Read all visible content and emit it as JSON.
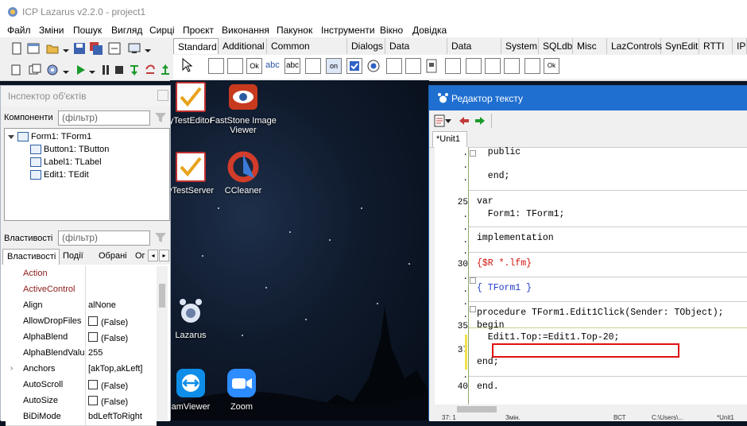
{
  "window": {
    "title": "ICP Lazarus v2.2.0 - project1"
  },
  "menu": [
    "Файл",
    "Зміни",
    "Пошук",
    "Вигляд",
    "Сирці",
    "Проєкт",
    "Виконання",
    "Пакунок",
    "Інструменти",
    "Вікно",
    "Довідка"
  ],
  "palette": {
    "tabs": [
      "Standard",
      "Additional",
      "Common Controls",
      "Dialogs",
      "Data Controls",
      "Data Access",
      "System",
      "SQLdb",
      "Misc",
      "LazControls",
      "SynEdit",
      "RTTI",
      "IPro"
    ],
    "active_tab": "Standard",
    "icon_labels": {
      "ok": "Ok",
      "abc": "abc",
      "on": "on"
    }
  },
  "desktop": {
    "icons": [
      {
        "label": "yTestEditor"
      },
      {
        "label": "FastStone Image Viewer"
      },
      {
        "label": "yTestServer"
      },
      {
        "label": "CCleaner"
      },
      {
        "label": "Lazarus"
      },
      {
        "label": "amViewer"
      },
      {
        "label": "Zoom"
      }
    ]
  },
  "inspector": {
    "title": "Інспектор об'єктів",
    "components_label": "Компоненти",
    "filter_placeholder": "(фільтр)",
    "tree": [
      "Form1: TForm1",
      "Button1: TButton",
      "Label1: TLabel",
      "Edit1: TEdit"
    ],
    "properties_label": "Властивості",
    "tabs": [
      "Властивості",
      "Події",
      "Обрані",
      "Ог"
    ],
    "rows": [
      {
        "name": "Action",
        "value": "",
        "red": true
      },
      {
        "name": "ActiveControl",
        "value": "",
        "red": true
      },
      {
        "name": "Align",
        "value": "alNone"
      },
      {
        "name": "AllowDropFiles",
        "value": "(False)",
        "check": true
      },
      {
        "name": "AlphaBlend",
        "value": "(False)",
        "check": true
      },
      {
        "name": "AlphaBlendValu",
        "value": "255"
      },
      {
        "name": "Anchors",
        "value": "[akTop,akLeft]",
        "expand": true
      },
      {
        "name": "AutoScroll",
        "value": "(False)",
        "check": true
      },
      {
        "name": "AutoSize",
        "value": "(False)",
        "check": true
      },
      {
        "name": "BiDiMode",
        "value": "bdLeftToRight"
      }
    ]
  },
  "editor": {
    "title": "Редактор тексту",
    "tab": "*Unit1",
    "gutter": [
      ".",
      ".",
      ".",
      "25",
      ".",
      ".",
      ".",
      ".",
      "30",
      ".",
      ".",
      ".",
      ".",
      "35",
      ".",
      "37",
      ".",
      ".",
      "40"
    ],
    "lines": {
      "public": "  public",
      "end_priv": "  end;",
      "var": "var",
      "form1": "  Form1: TForm1;",
      "implementation": "implementation",
      "res": "{$R *.lfm}",
      "comment": "{ TForm1 }",
      "proc": "procedure TForm1.Edit1Click(Sender: TObject);",
      "begin": "begin",
      "stmt": "  Edit1.Top:=Edit1.Top-20;",
      "end1": "end;",
      "end2": "end."
    },
    "status": [
      "37: 1",
      "Змін.",
      "ВСТ",
      "C:\\Users\\...",
      "*Unit1"
    ]
  }
}
